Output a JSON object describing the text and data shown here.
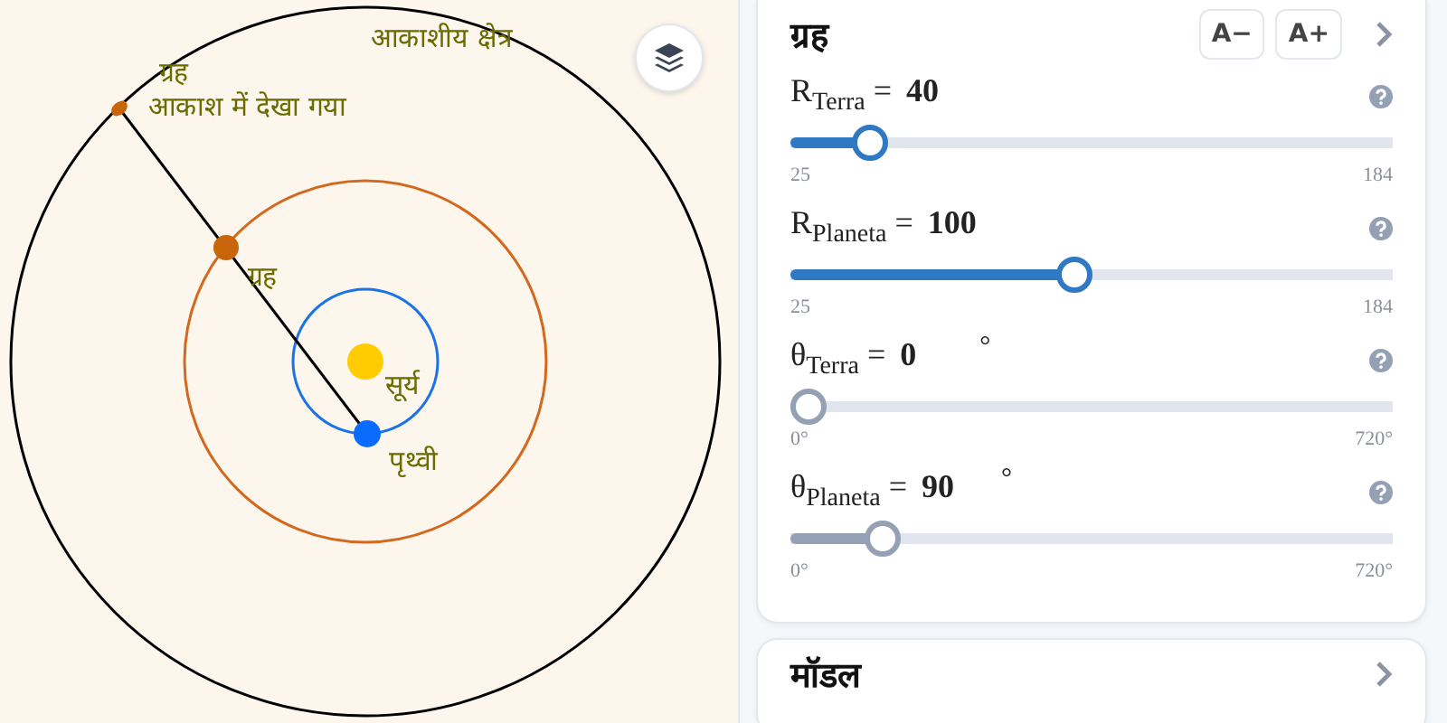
{
  "diagram": {
    "labels": [
      {
        "text": "आकाशीय क्षेत्र"
      },
      {
        "text": "ग्रह"
      },
      {
        "text": "आकाश में देखा गया"
      },
      {
        "text": "ग्रह"
      },
      {
        "text": "सूर्य"
      },
      {
        "text": "पृथ्वी"
      }
    ]
  },
  "panel": {
    "title": "ग्रह",
    "buttons": [
      "A−",
      "A+"
    ],
    "sliders": [
      {
        "label": "R$_{Terra}$ =",
        "value": "40",
        "min": "25",
        "max": "184",
        "level": 0.11,
        "color": "#2f78c4"
      },
      {
        "label": "R$_{Planeta}$ =",
        "value": "100",
        "min": "25",
        "max": "184",
        "level": 0.47,
        "color": "#2f78c4"
      },
      {
        "label": "θ$_{Terra}$ =",
        "value": "0",
        "unit": "°",
        "min": "0°",
        "max": "720°",
        "level": 0,
        "color": "#94a0b4"
      },
      {
        "label": "θ$_{Planeta}$ =",
        "value": "90",
        "unit": "°",
        "min": "0°",
        "max": "720°",
        "level": 0.13,
        "color": "#94a0b4"
      }
    ]
  },
  "next_panel": {
    "title": "मॉडल"
  }
}
